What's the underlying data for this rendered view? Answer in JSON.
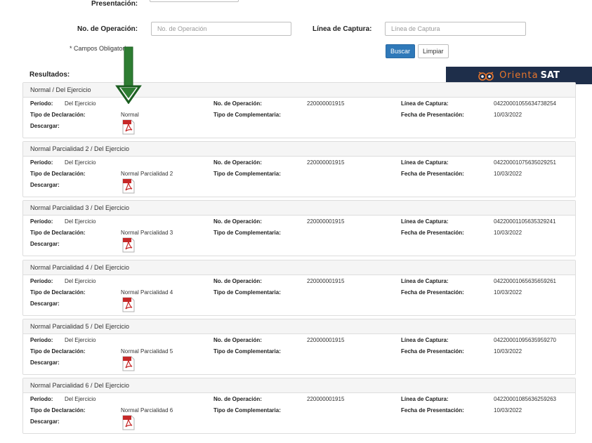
{
  "form": {
    "presentacion_label": "Presentación:",
    "operacion_label": "No. de Operación:",
    "operacion_placeholder": "No. de Operación",
    "captura_label": "Línea de Captura:",
    "captura_placeholder": "Línea de Captura",
    "required_note": "* Campos Obligatorios",
    "buscar_label": "Buscar",
    "limpiar_label": "Limpiar"
  },
  "results": {
    "title": "Resultados:"
  },
  "banner": {
    "brand_part1": "Orienta",
    "brand_part2": "SAT",
    "colors": {
      "bg": "#1e2e4a",
      "accent": "#e9762b"
    }
  },
  "annotation": {
    "arrow_color": "#2e7d32",
    "icon": "down-arrow-icon"
  },
  "field_labels": {
    "periodo": "Período:",
    "tipo_declaracion": "Tipo de Declaración:",
    "descargar": "Descargar:",
    "no_operacion": "No. de Operación:",
    "tipo_complementaria": "Tipo de Complementaria:",
    "linea_captura": "Línea de Captura:",
    "fecha_presentacion": "Fecha de Presentación:"
  },
  "records": [
    {
      "header": "Normal / Del Ejercicio",
      "periodo": "Del Ejercicio",
      "tipo": "Normal",
      "operacion": "220000001915",
      "linea": "04220001055634738254",
      "fecha": "10/03/2022"
    },
    {
      "header": "Normal Parcialidad 2 / Del Ejercicio",
      "periodo": "Del Ejercicio",
      "tipo": "Normal Parcialidad 2",
      "operacion": "220000001915",
      "linea": "04220001075635029251",
      "fecha": "10/03/2022"
    },
    {
      "header": "Normal Parcialidad 3 / Del Ejercicio",
      "periodo": "Del Ejercicio",
      "tipo": "Normal Parcialidad 3",
      "operacion": "220000001915",
      "linea": "04220001105635329241",
      "fecha": "10/03/2022"
    },
    {
      "header": "Normal Parcialidad 4 / Del Ejercicio",
      "periodo": "Del Ejercicio",
      "tipo": "Normal Parcialidad 4",
      "operacion": "220000001915",
      "linea": "04220001065635659261",
      "fecha": "10/03/2022"
    },
    {
      "header": "Normal Parcialidad 5 / Del Ejercicio",
      "periodo": "Del Ejercicio",
      "tipo": "Normal Parcialidad 5",
      "operacion": "220000001915",
      "linea": "04220001095635959270",
      "fecha": "10/03/2022"
    },
    {
      "header": "Normal Parcialidad 6 / Del Ejercicio",
      "periodo": "Del Ejercicio",
      "tipo": "Normal Parcialidad 6",
      "operacion": "220000001915",
      "linea": "04220001085636259263",
      "fecha": "10/03/2022"
    }
  ]
}
